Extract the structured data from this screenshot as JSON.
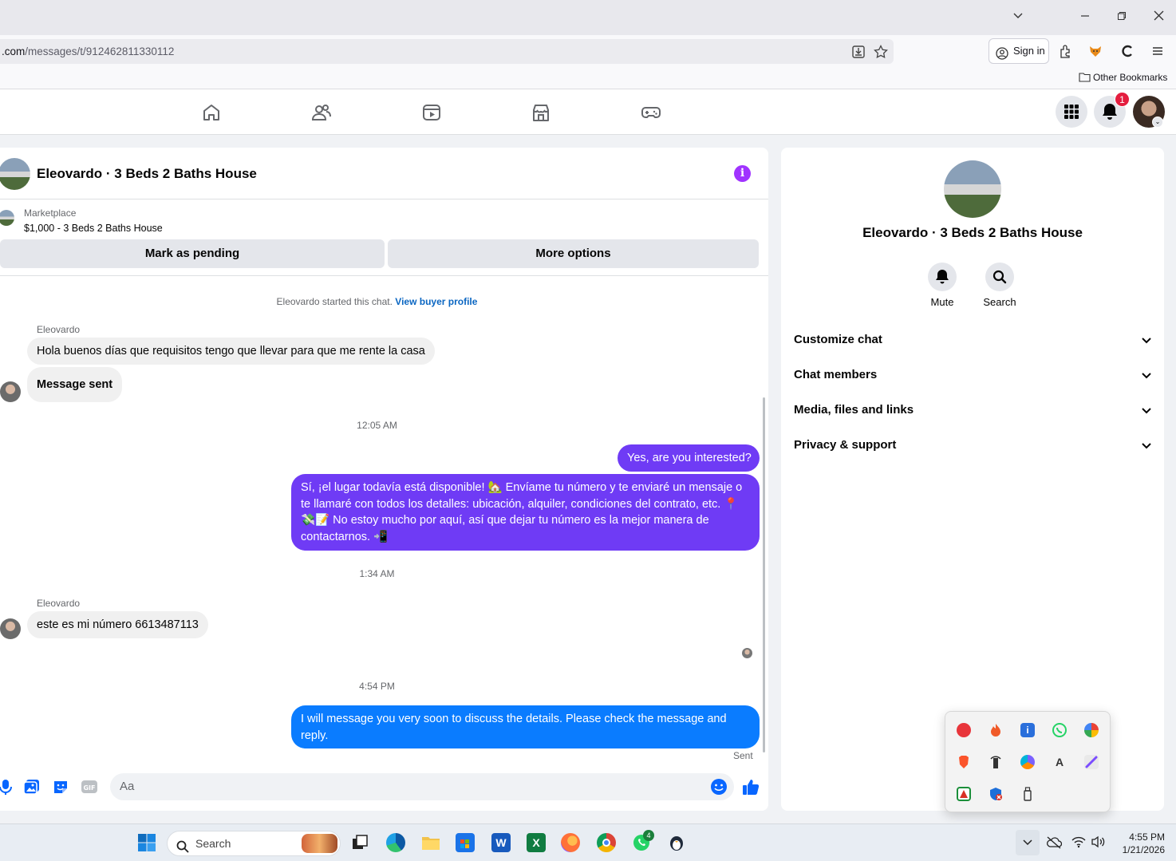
{
  "browser": {
    "url_domain": ".com",
    "url_path": "/messages/t/912462811330112",
    "sign_in_label": "Sign in",
    "bookmarks_folder": "Other Bookmarks"
  },
  "fb_nav": {
    "notification_count": "1"
  },
  "chat": {
    "title": "Eleovardo · 3 Beds 2 Baths House",
    "marketplace_label": "Marketplace",
    "listing": "$1,000 - 3 Beds 2 Baths House",
    "mark_pending_label": "Mark as pending",
    "more_options_label": "More options",
    "started_text": "Eleovardo started this chat.",
    "buyer_profile_link": "View buyer profile",
    "messages": [
      {
        "sender": "Eleovardo",
        "text": "Hola buenos días que requisitos tengo que llevar para que me rente la casa"
      },
      {
        "text": "Message sent"
      },
      {
        "timestamp": "12:05 AM"
      },
      {
        "text": "Yes, are you interested?"
      },
      {
        "text": "Sí, ¡el lugar todavía está disponible! 🏡 Envíame tu número y te enviaré un mensaje o te llamaré con todos los detalles: ubicación, alquiler, condiciones del contrato, etc. 📍💸📝 No estoy mucho por aquí, así que dejar tu número es la mejor manera de contactarnos. 📲"
      },
      {
        "timestamp": "1:34 AM"
      },
      {
        "sender": "Eleovardo",
        "text": "este es mi número 6613487113"
      },
      {
        "timestamp": "4:54 PM"
      },
      {
        "text": "I will message you very soon to discuss the details. Please check the message and reply."
      }
    ],
    "sent_status": "Sent",
    "composer_placeholder": "Aa"
  },
  "info_panel": {
    "name": "Eleovardo · 3 Beds 2 Baths House",
    "mute_label": "Mute",
    "search_label": "Search",
    "sections": [
      "Customize chat",
      "Chat members",
      "Media, files and links",
      "Privacy & support"
    ]
  },
  "taskbar": {
    "search_placeholder": "Search",
    "whatsapp_badge": "4",
    "time": "4:55 PM",
    "date": "1/21/2026"
  },
  "colors": {
    "accent_purple": "#6f3bf5",
    "accent_blue": "#0a7cff",
    "fb_blue": "#0866ff",
    "info_purple": "#a033ff"
  }
}
